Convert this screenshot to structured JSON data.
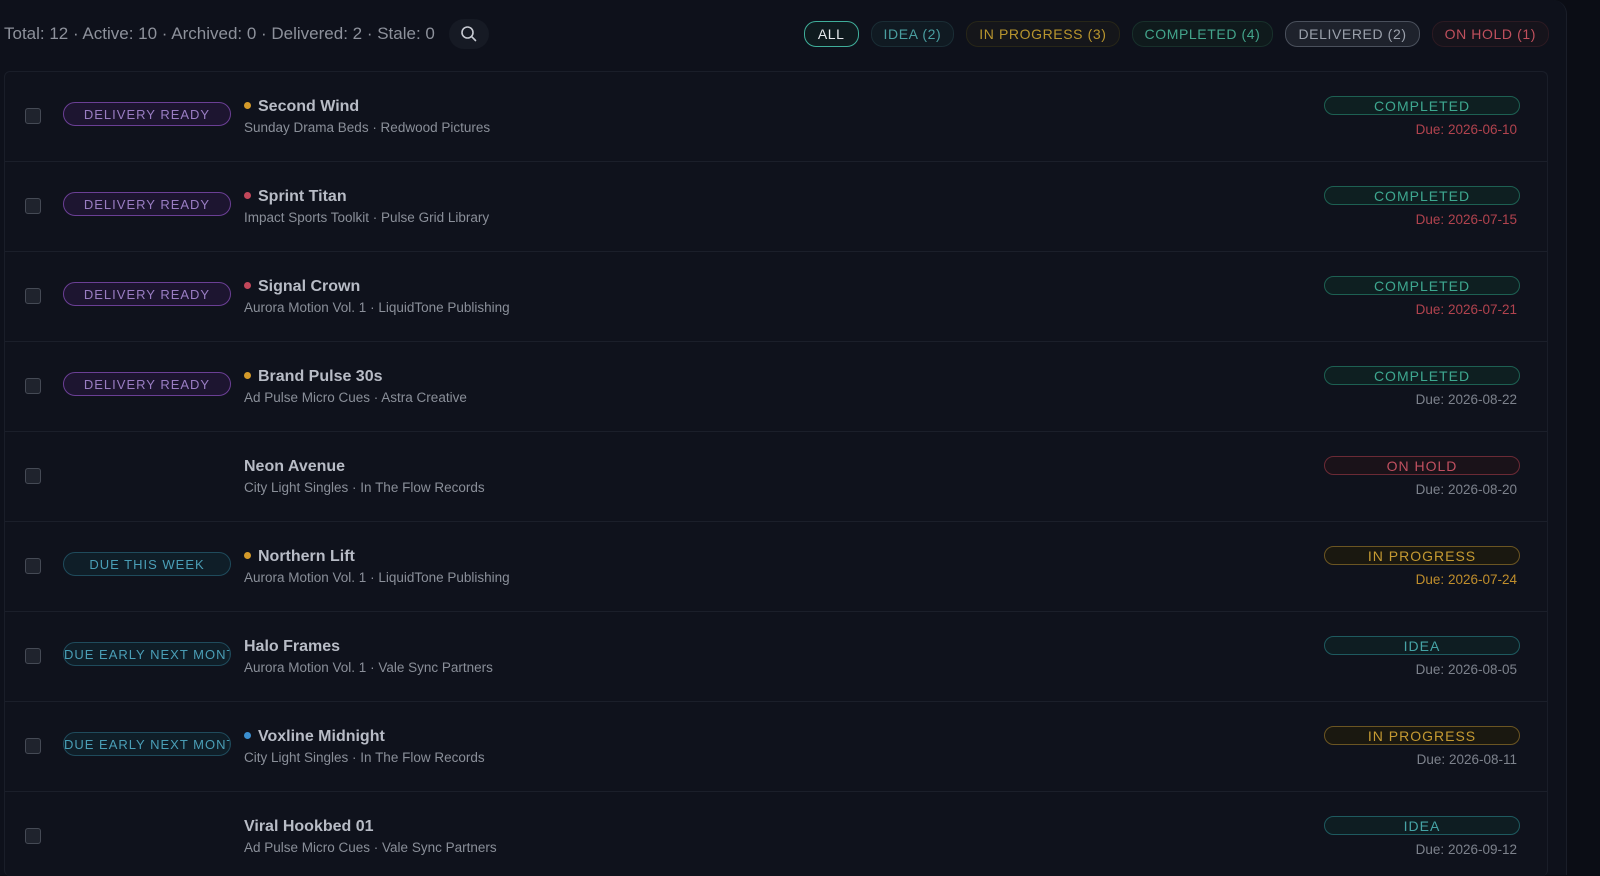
{
  "summary": {
    "text": "Total: 12 · Active: 10 · Archived: 0 · Delivered: 2 · Stale: 0"
  },
  "filters": [
    {
      "label": "ALL",
      "kind": "all"
    },
    {
      "label": "IDEA (2)",
      "kind": "idea"
    },
    {
      "label": "IN PROGRESS (3)",
      "kind": "inprog"
    },
    {
      "label": "COMPLETED (4)",
      "kind": "completed"
    },
    {
      "label": "DELIVERED (2)",
      "kind": "delivered"
    },
    {
      "label": "ON HOLD (1)",
      "kind": "onhold"
    }
  ],
  "colors": {
    "dot_amber": "#d49a2a",
    "dot_red": "#c2475a",
    "dot_blue": "#3b8fd0"
  },
  "rows": [
    {
      "tag": "DELIVERY READY",
      "tag_kind": "ready",
      "dot": "amber",
      "title": "Second Wind",
      "subtitle": "Sunday Drama Beds · Redwood Pictures",
      "status": "COMPLETED",
      "status_kind": "completed",
      "due": "Due: 2026-06-10",
      "due_kind": "red"
    },
    {
      "tag": "DELIVERY READY",
      "tag_kind": "ready",
      "dot": "red",
      "title": "Sprint Titan",
      "subtitle": "Impact Sports Toolkit · Pulse Grid Library",
      "status": "COMPLETED",
      "status_kind": "completed",
      "due": "Due: 2026-07-15",
      "due_kind": "red"
    },
    {
      "tag": "DELIVERY READY",
      "tag_kind": "ready",
      "dot": "red",
      "title": "Signal Crown",
      "subtitle": "Aurora Motion Vol. 1 · LiquidTone Publishing",
      "status": "COMPLETED",
      "status_kind": "completed",
      "due": "Due: 2026-07-21",
      "due_kind": "red"
    },
    {
      "tag": "DELIVERY READY",
      "tag_kind": "ready",
      "dot": "amber",
      "title": "Brand Pulse 30s",
      "subtitle": "Ad Pulse Micro Cues · Astra Creative",
      "status": "COMPLETED",
      "status_kind": "completed",
      "due": "Due: 2026-08-22",
      "due_kind": "gray"
    },
    {
      "tag": "",
      "tag_kind": "",
      "dot": "",
      "title": "Neon Avenue",
      "subtitle": "City Light Singles · In The Flow Records",
      "status": "ON HOLD",
      "status_kind": "onhold",
      "due": "Due: 2026-08-20",
      "due_kind": "gray"
    },
    {
      "tag": "DUE THIS WEEK",
      "tag_kind": "week",
      "dot": "amber",
      "title": "Northern Lift",
      "subtitle": "Aurora Motion Vol. 1 · LiquidTone Publishing",
      "status": "IN PROGRESS",
      "status_kind": "inprog",
      "due": "Due: 2026-07-24",
      "due_kind": "amber"
    },
    {
      "tag": "DUE EARLY NEXT MONTH",
      "tag_kind": "month",
      "dot": "",
      "title": "Halo Frames",
      "subtitle": "Aurora Motion Vol. 1 · Vale Sync Partners",
      "status": "IDEA",
      "status_kind": "idea",
      "due": "Due: 2026-08-05",
      "due_kind": "gray"
    },
    {
      "tag": "DUE EARLY NEXT MONTH",
      "tag_kind": "month",
      "dot": "blue",
      "title": "Voxline Midnight",
      "subtitle": "City Light Singles · In The Flow Records",
      "status": "IN PROGRESS",
      "status_kind": "inprog",
      "due": "Due: 2026-08-11",
      "due_kind": "gray"
    },
    {
      "tag": "",
      "tag_kind": "",
      "dot": "",
      "title": "Viral Hookbed 01",
      "subtitle": "Ad Pulse Micro Cues · Vale Sync Partners",
      "status": "IDEA",
      "status_kind": "idea",
      "due": "Due: 2026-09-12",
      "due_kind": "gray"
    }
  ]
}
